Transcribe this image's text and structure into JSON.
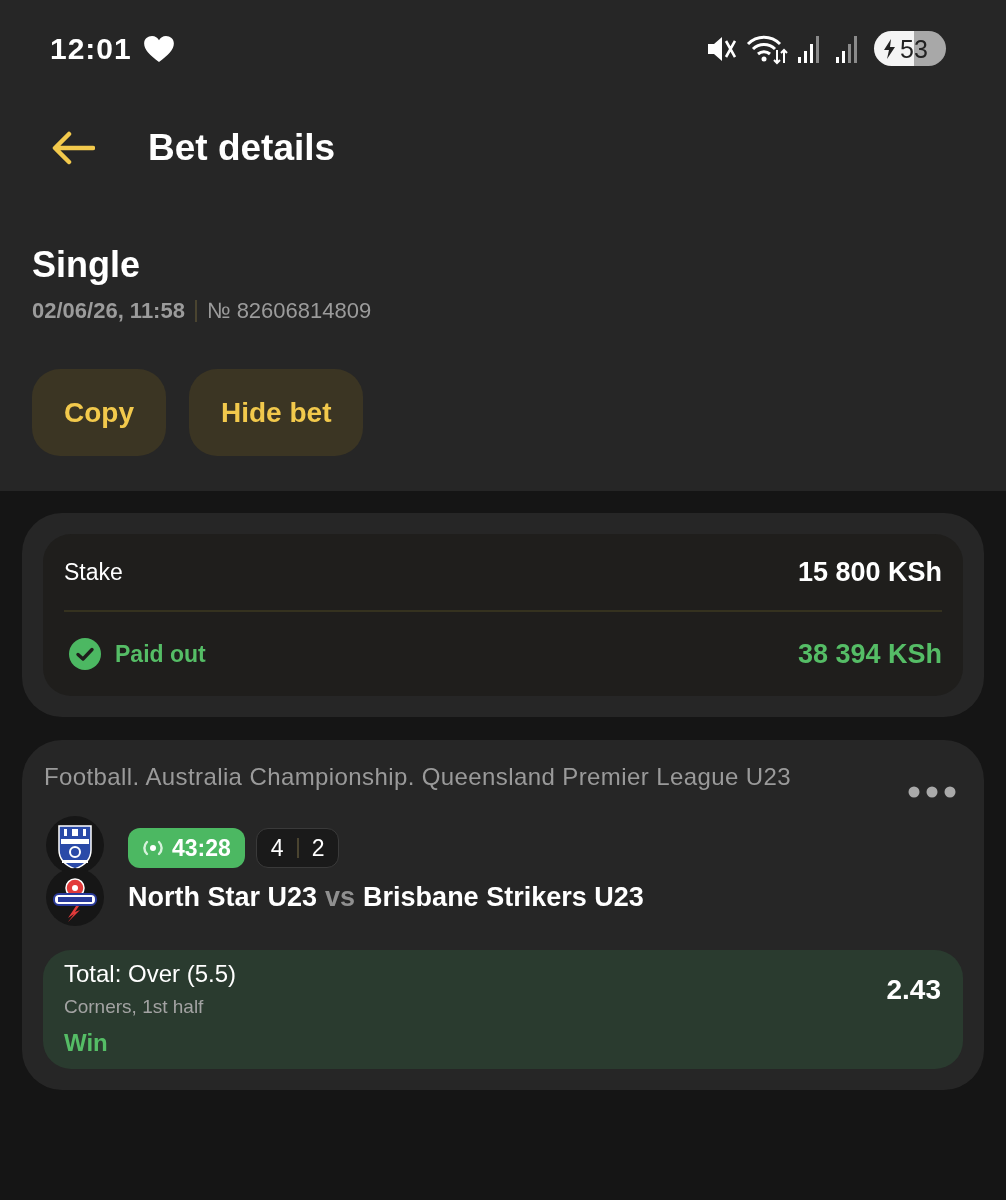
{
  "status_bar": {
    "time": "12:01",
    "battery": "53"
  },
  "header": {
    "title": "Bet details"
  },
  "bet": {
    "type": "Single",
    "date": "02/06/26, 11:58",
    "number": "№ 82606814809"
  },
  "actions": [
    {
      "label": "Copy"
    },
    {
      "label": "Hide bet"
    }
  ],
  "summary": {
    "rows": [
      {
        "kind": "stake",
        "label": "Stake",
        "amount": "15 800 KSh"
      },
      {
        "kind": "paid",
        "label": "Paid out",
        "amount": "38 394 KSh"
      }
    ]
  },
  "event": {
    "league": "Football. Australia Championship. Queensland Premier League U23",
    "live_time": "43:28",
    "score": [
      "4",
      "2"
    ],
    "home": "North Star U23",
    "vs": "vs",
    "away": "Brisbane Strikers U23",
    "selection": {
      "market": "Total: Over (5.5)",
      "detail": "Corners, 1st half",
      "result": "Win",
      "odds": "2.43"
    }
  }
}
